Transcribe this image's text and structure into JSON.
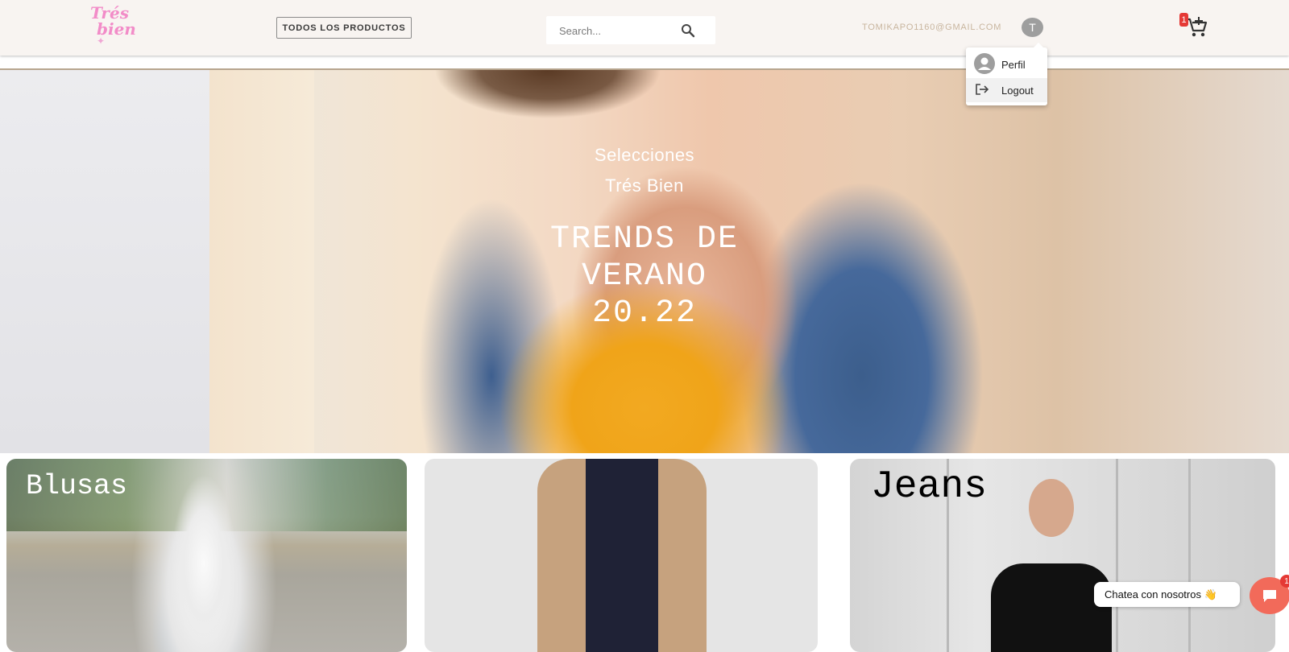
{
  "header": {
    "logo": {
      "line1": "Trés",
      "line2": "bien"
    },
    "all_products_label": "TODOS LOS PRODUCTOS",
    "search": {
      "placeholder": "Search...",
      "value": ""
    },
    "user_email": "TOMIKAPO1160@GMAIL.COM",
    "avatar_initial": "T",
    "cart": {
      "badge_count": "1"
    }
  },
  "user_menu": {
    "items": [
      {
        "label": "Perfil",
        "icon": "account-circle-icon"
      },
      {
        "label": "Logout",
        "icon": "logout-icon"
      }
    ]
  },
  "hero": {
    "subtitle_line1": "Selecciones",
    "subtitle_line2": "Trés Bien",
    "headline_line1": "TRENDS DE",
    "headline_line2": "VERANO",
    "headline_line3": "20.22"
  },
  "categories": [
    {
      "label": "Blusas"
    },
    {
      "label": ""
    },
    {
      "label": "Jeans"
    }
  ],
  "chat": {
    "prompt": "Chatea con nosotros 👋",
    "badge_count": "1"
  },
  "colors": {
    "header_bg": "#f8f4f1",
    "logo_pink": "#f28cc8",
    "email_text": "#c8b59e",
    "cart_badge": "#e53935",
    "chat_button": "#f26a5a"
  }
}
